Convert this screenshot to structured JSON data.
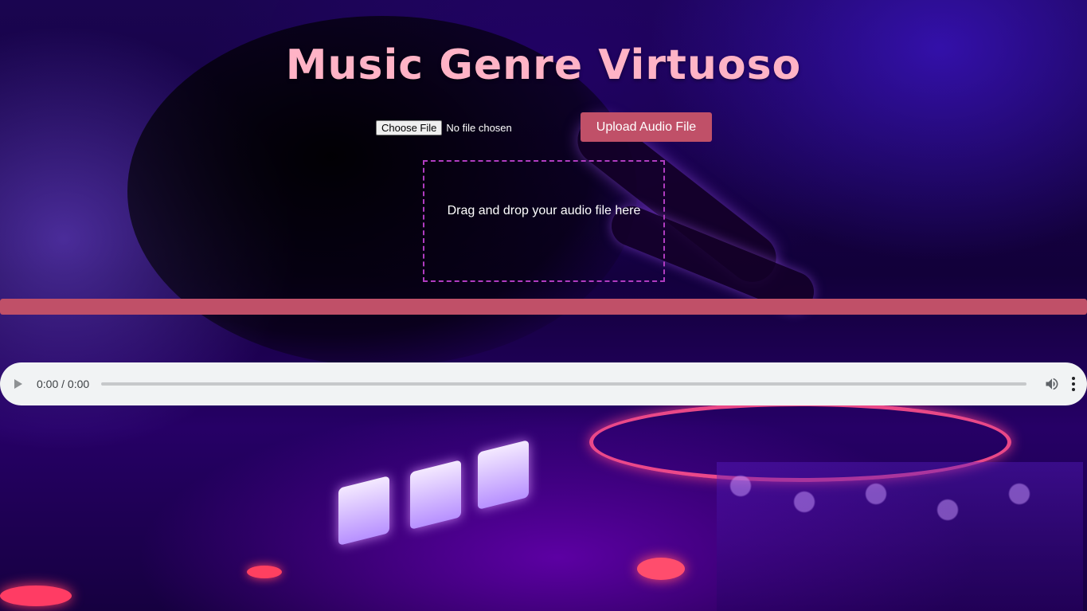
{
  "page": {
    "title": "Music Genre Virtuoso"
  },
  "upload": {
    "choose_file_label": "Choose File",
    "file_status": "No file chosen",
    "upload_button_label": "Upload Audio File"
  },
  "drop_zone": {
    "text": "Drag and drop your audio file here"
  },
  "progress": {
    "value": 1.0
  },
  "player": {
    "time": "0:00 / 0:00",
    "play_icon": "play-icon",
    "volume_icon": "volume-icon",
    "more_icon": "more-vert-icon"
  },
  "colors": {
    "title": "#ffb3c6",
    "accent": "#c05068",
    "drop_border": "#b03cc0",
    "player_bg": "#f1f3f4"
  }
}
